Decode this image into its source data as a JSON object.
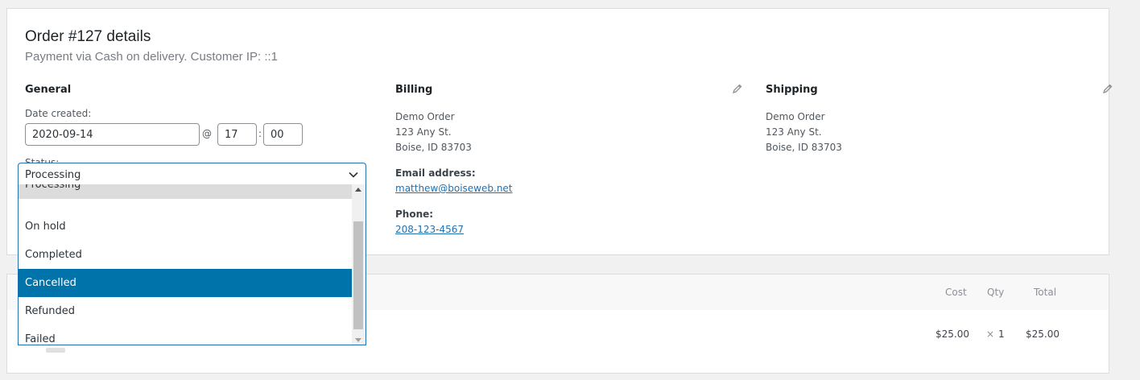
{
  "order": {
    "title": "Order #127 details",
    "subtitle": "Payment via Cash on delivery. Customer IP: ::1"
  },
  "general": {
    "heading": "General",
    "date_label": "Date created:",
    "date_value": "2020-09-14",
    "at_symbol": "@",
    "hour": "17",
    "colon": ":",
    "minute": "00",
    "status_label": "Status:",
    "status_value": "Processing",
    "status_options": [
      "Processing",
      "On hold",
      "Completed",
      "Cancelled",
      "Refunded",
      "Failed"
    ],
    "highlighted_option": "Cancelled",
    "selection_color": "#0073aa"
  },
  "billing": {
    "heading": "Billing",
    "address": [
      "Demo Order",
      "123 Any St.",
      "Boise, ID 83703"
    ],
    "email_label": "Email address:",
    "email": "matthew@boiseweb.net",
    "phone_label": "Phone:",
    "phone": "208-123-4567",
    "edit_icon": "pencil-icon"
  },
  "shipping": {
    "heading": "Shipping",
    "address": [
      "Demo Order",
      "123 Any St.",
      "Boise, ID 83703"
    ],
    "edit_icon": "pencil-icon"
  },
  "items": {
    "columns": {
      "cost": "Cost",
      "qty": "Qty",
      "total": "Total"
    },
    "rows": [
      {
        "cost": "$25.00",
        "qty_symbol": "×",
        "qty": "1",
        "total": "$25.00"
      }
    ]
  },
  "colors": {
    "link": "#2271b1",
    "focus_border": "#2271b1"
  }
}
